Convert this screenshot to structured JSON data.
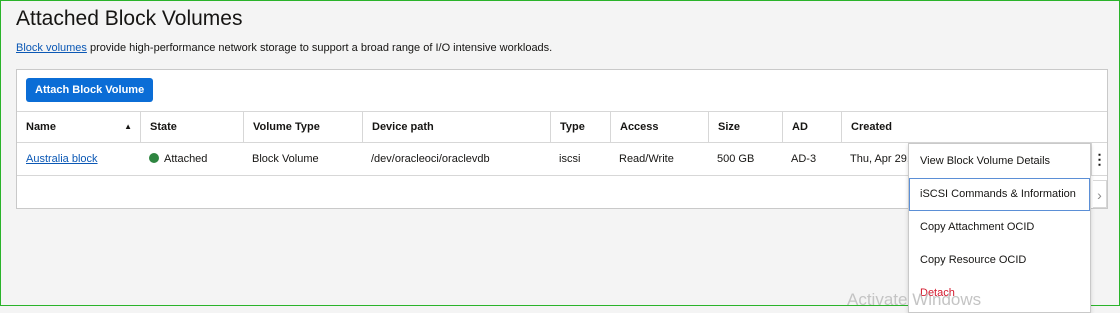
{
  "page": {
    "title": "Attached Block Volumes",
    "desc_link": "Block volumes",
    "desc_rest": " provide high-performance network storage to support a broad range of I/O intensive workloads."
  },
  "toolbar": {
    "attach_label": "Attach Block Volume"
  },
  "table": {
    "columns": [
      "Name",
      "State",
      "Volume Type",
      "Device path",
      "Type",
      "Access",
      "Size",
      "AD",
      "Created"
    ],
    "row": {
      "name": "Australia block",
      "state": "Attached",
      "volume_type": "Block Volume",
      "device_path": "/dev/oracleoci/oraclevdb",
      "type": "iscsi",
      "access": "Read/Write",
      "size": "500 GB",
      "ad": "AD-3",
      "created": "Thu, Apr 29,"
    }
  },
  "menu": {
    "items": [
      "View Block Volume Details",
      "iSCSI Commands & Information",
      "Copy Attachment OCID",
      "Copy Resource OCID",
      "Detach"
    ]
  },
  "overlay": {
    "watermark": "Activate Windows"
  },
  "colors": {
    "accent": "#0b6dd6",
    "attached": "#2e8540",
    "danger": "#d3182c"
  },
  "icons": {
    "sort": "caret-up-icon",
    "kebab": "kebab-icon",
    "chevron": "chevron-right-icon"
  }
}
